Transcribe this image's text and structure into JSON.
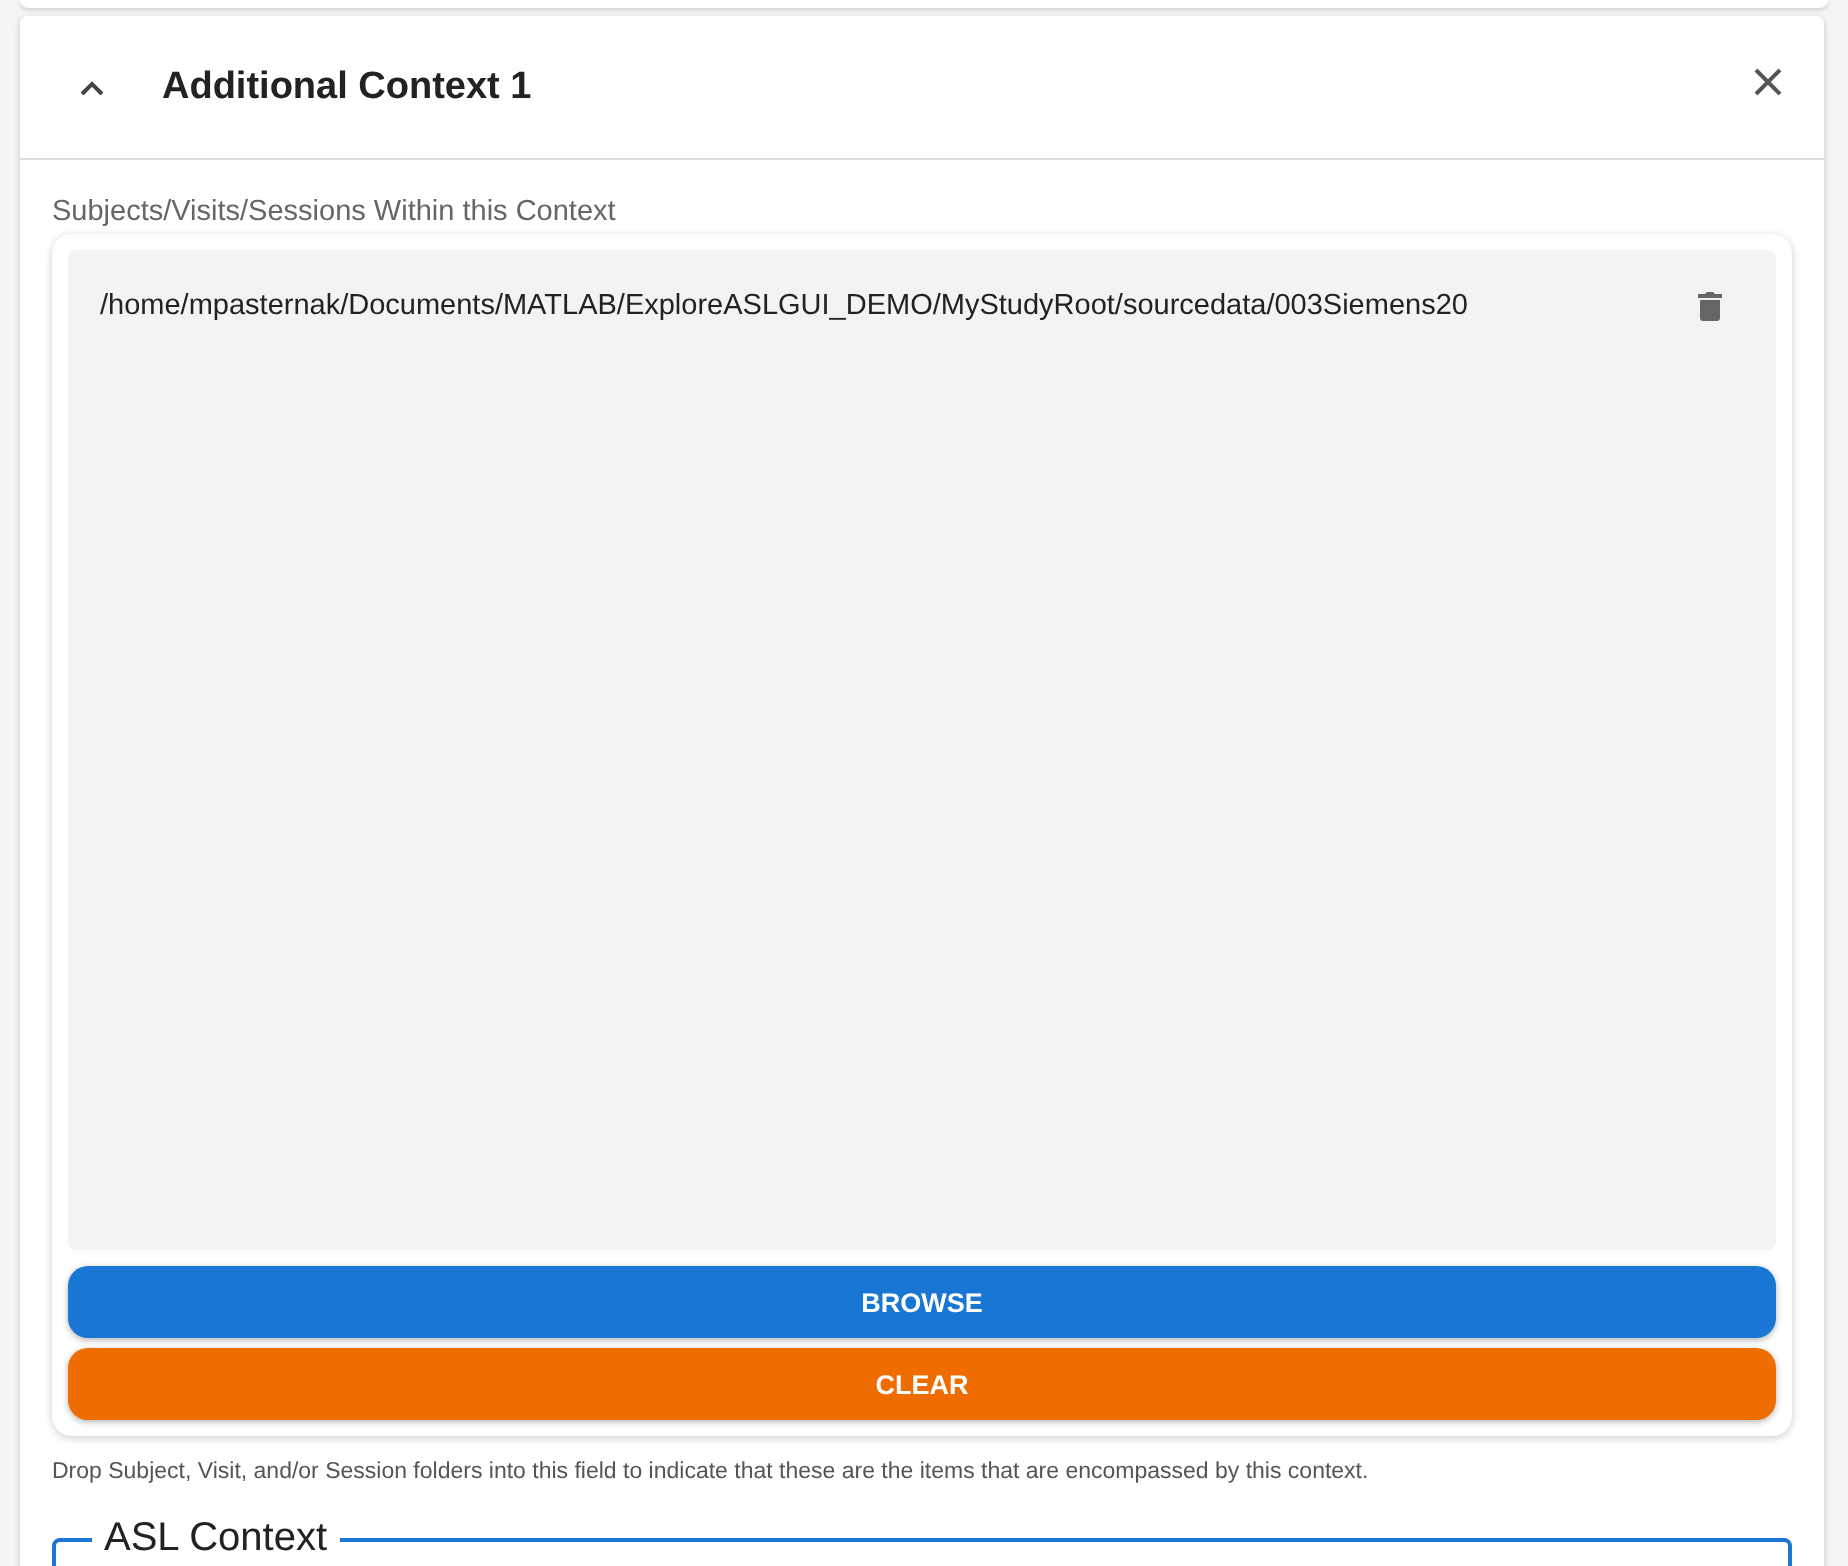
{
  "panel": {
    "title": "Additional Context 1",
    "expanded": true
  },
  "dropzone": {
    "label": "Subjects/Visits/Sessions Within this Context",
    "items": [
      {
        "path": "/home/mpasternak/Documents/MATLAB/ExploreASLGUI_DEMO/MyStudyRoot/sourcedata/003Siemens20"
      }
    ],
    "buttons": [
      {
        "label": "BROWSE",
        "kind": "primary"
      },
      {
        "label": "CLEAR",
        "kind": "warning"
      }
    ],
    "helper_text": "Drop Subject, Visit, and/or Session folders into this field to indicate that these are the items that are encompassed by this context."
  },
  "section": {
    "legend": "ASL Context"
  }
}
